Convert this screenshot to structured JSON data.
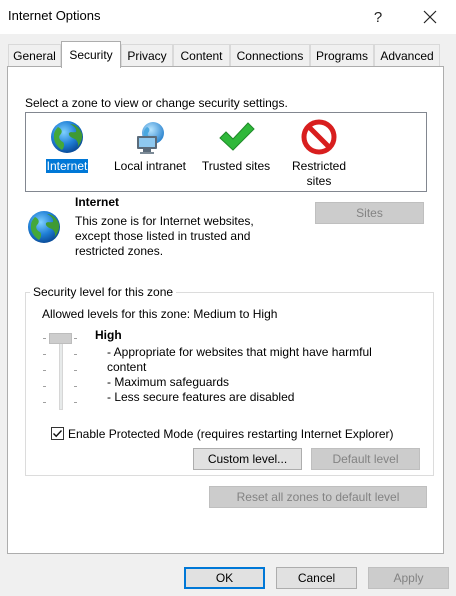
{
  "window": {
    "title": "Internet Options"
  },
  "tabs": [
    {
      "label": "General"
    },
    {
      "label": "Security",
      "active": true
    },
    {
      "label": "Privacy"
    },
    {
      "label": "Content"
    },
    {
      "label": "Connections"
    },
    {
      "label": "Programs"
    },
    {
      "label": "Advanced"
    }
  ],
  "zones": {
    "prompt": "Select a zone to view or change security settings.",
    "items": [
      {
        "name": "Internet",
        "icon": "globe-icon",
        "selected": true
      },
      {
        "name": "Local intranet",
        "icon": "intranet-icon"
      },
      {
        "name": "Trusted sites",
        "icon": "checkmark-icon"
      },
      {
        "name": "Restricted sites",
        "icon": "restricted-icon"
      }
    ]
  },
  "zone_info": {
    "title": "Internet",
    "description": "This zone is for Internet websites, except those listed in trusted and restricted zones.",
    "sites_button": "Sites"
  },
  "security_level": {
    "group_label": "Security level for this zone",
    "allowed": "Allowed levels for this zone: Medium to High",
    "level_name": "High",
    "bullets": [
      "- Appropriate for websites that might have harmful content",
      "- Maximum safeguards",
      "- Less secure features are disabled"
    ],
    "slider_level": "High",
    "protected_mode_label": "Enable Protected Mode (requires restarting Internet Explorer)",
    "protected_mode_checked": true,
    "custom_level_button": "Custom level...",
    "default_level_button": "Default level"
  },
  "reset_button": "Reset all zones to default level",
  "footer": {
    "ok": "OK",
    "cancel": "Cancel",
    "apply": "Apply"
  },
  "colors": {
    "accent": "#0078d7",
    "panel": "#ffffff",
    "window": "#f0f0f0"
  }
}
